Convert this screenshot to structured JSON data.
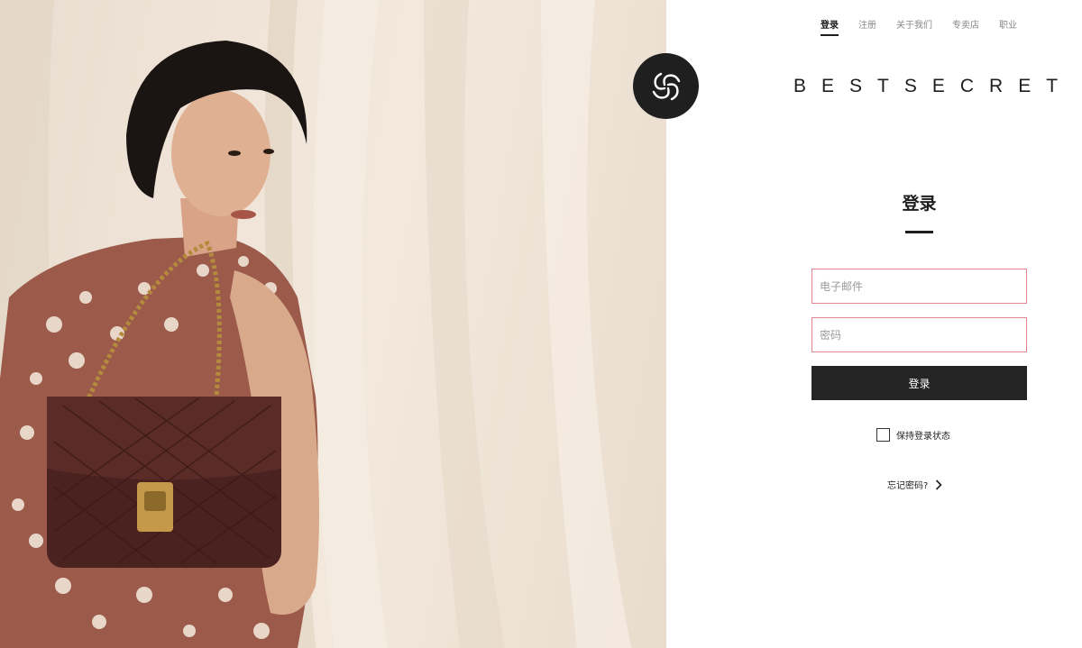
{
  "nav": {
    "items": [
      {
        "label": "登录",
        "active": true
      },
      {
        "label": "注册",
        "active": false
      },
      {
        "label": "关于我们",
        "active": false
      },
      {
        "label": "专卖店",
        "active": false
      },
      {
        "label": "职业",
        "active": false
      }
    ]
  },
  "brand": {
    "wordmark": "BESTSECRET",
    "logo_icon": "bestsecret-knot-logo"
  },
  "login": {
    "title": "登录",
    "email_placeholder": "电子邮件",
    "email_value": "",
    "password_placeholder": "密码",
    "password_value": "",
    "submit_label": "登录",
    "remember_label": "保持登录状态",
    "remember_checked": false,
    "forgot_label": "忘记密码?",
    "forgot_icon": "chevron-right-icon"
  },
  "hero": {
    "image": "woman-with-quilted-brown-handbag-photo"
  },
  "colors": {
    "accent_dark": "#242424",
    "field_border": "#e2848e",
    "hero_background": "#efe4d7"
  }
}
